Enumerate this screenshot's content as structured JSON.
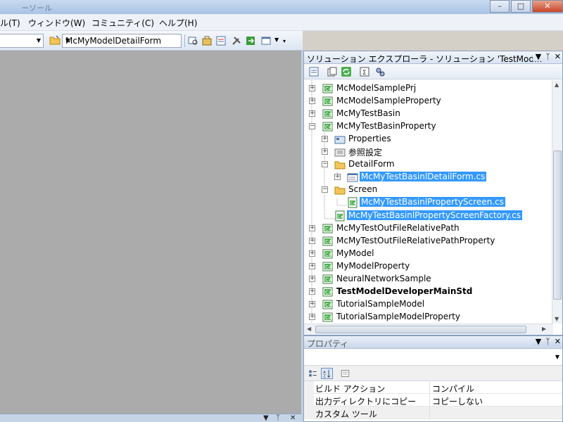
{
  "window": {
    "title": "ーソール",
    "buttons": [
      "minimize",
      "maximize",
      "close"
    ]
  },
  "menu": [
    {
      "label": "ル(T)"
    },
    {
      "label": "ウィンドウ(W)"
    },
    {
      "label": "コミュニティ(C)"
    },
    {
      "label": "ヘルプ(H)"
    }
  ],
  "toolbar": {
    "config_dropdown_value": "",
    "form_dropdown_value": "McMyModelDetailForm",
    "icons": [
      "folder-open-icon",
      "find-icon",
      "toolbox-icon",
      "properties-icon",
      "tools-icon",
      "export-icon",
      "window-icon"
    ]
  },
  "solution_explorer": {
    "title": "ソリューション エクスプローラ - ソリューション 'TestMod...",
    "header_controls": [
      "dropdown",
      "pin",
      "close"
    ],
    "toolbar_icons": [
      "properties-icon",
      "show-all-files-icon",
      "refresh-icon",
      "view-code-icon",
      "class-view-icon"
    ],
    "tree": [
      {
        "label": "McModelSamplePrj",
        "level": 0,
        "expander": "+",
        "icon": "cs-project",
        "selected": false,
        "bold": false
      },
      {
        "label": "McModelSampleProperty",
        "level": 0,
        "expander": "+",
        "icon": "cs-project",
        "selected": false,
        "bold": false
      },
      {
        "label": "McMyTestBasin",
        "level": 0,
        "expander": "+",
        "icon": "cs-project",
        "selected": false,
        "bold": false
      },
      {
        "label": "McMyTestBasinProperty",
        "level": 0,
        "expander": "-",
        "icon": "cs-project",
        "selected": false,
        "bold": false
      },
      {
        "label": "Properties",
        "level": 1,
        "expander": "+",
        "icon": "properties-folder",
        "selected": false,
        "bold": false
      },
      {
        "label": "参照設定",
        "level": 1,
        "expander": "+",
        "icon": "references-folder",
        "selected": false,
        "bold": false
      },
      {
        "label": "DetailForm",
        "level": 1,
        "expander": "-",
        "icon": "folder",
        "selected": false,
        "bold": false
      },
      {
        "label": "McMyTestBasinlDetailForm.cs",
        "level": 2,
        "expander": "+",
        "icon": "form-file",
        "selected": true,
        "bold": false
      },
      {
        "label": "Screen",
        "level": 1,
        "expander": "-",
        "icon": "folder",
        "selected": false,
        "bold": false
      },
      {
        "label": "McMyTestBasinlPropertyScreen.cs",
        "level": 2,
        "expander": "",
        "icon": "cs-file",
        "selected": true,
        "bold": false
      },
      {
        "label": "McMyTestBasinlPropertyScreenFactory.cs",
        "level": 1,
        "expander": "",
        "icon": "cs-file",
        "selected": true,
        "bold": false
      },
      {
        "label": "McMyTestOutFileRelativePath",
        "level": 0,
        "expander": "+",
        "icon": "cs-project",
        "selected": false,
        "bold": false
      },
      {
        "label": "McMyTestOutFileRelativePathProperty",
        "level": 0,
        "expander": "+",
        "icon": "cs-project",
        "selected": false,
        "bold": false
      },
      {
        "label": "MyModel",
        "level": 0,
        "expander": "+",
        "icon": "cs-project",
        "selected": false,
        "bold": false
      },
      {
        "label": "MyModelProperty",
        "level": 0,
        "expander": "+",
        "icon": "cs-project",
        "selected": false,
        "bold": false
      },
      {
        "label": "NeuralNetworkSample",
        "level": 0,
        "expander": "+",
        "icon": "cs-project",
        "selected": false,
        "bold": false
      },
      {
        "label": "TestModelDeveloperMainStd",
        "level": 0,
        "expander": "+",
        "icon": "cs-project",
        "selected": false,
        "bold": true
      },
      {
        "label": "TutorialSampleModel",
        "level": 0,
        "expander": "+",
        "icon": "cs-project",
        "selected": false,
        "bold": false
      },
      {
        "label": "TutorialSampleModelProperty",
        "level": 0,
        "expander": "+",
        "icon": "cs-project",
        "selected": false,
        "bold": false
      }
    ]
  },
  "properties": {
    "title": "プロパティ",
    "header_controls": [
      "dropdown",
      "pin",
      "close"
    ],
    "object_combo_value": "",
    "tool_icons": [
      "categorized-icon",
      "alphabetical-icon",
      "property-pages-icon"
    ],
    "rows": [
      {
        "key": "ビルド アクション",
        "value": "コンパイル"
      },
      {
        "key": "出力ディレクトリにコピー",
        "value": "コピーしない"
      },
      {
        "key": "カスタム ツール",
        "value": ""
      }
    ]
  },
  "bottom_panel": {
    "controls": [
      "dropdown",
      "pin",
      "close"
    ]
  },
  "colors": {
    "selection": "#3399ff",
    "editor_bg": "#ababab"
  }
}
